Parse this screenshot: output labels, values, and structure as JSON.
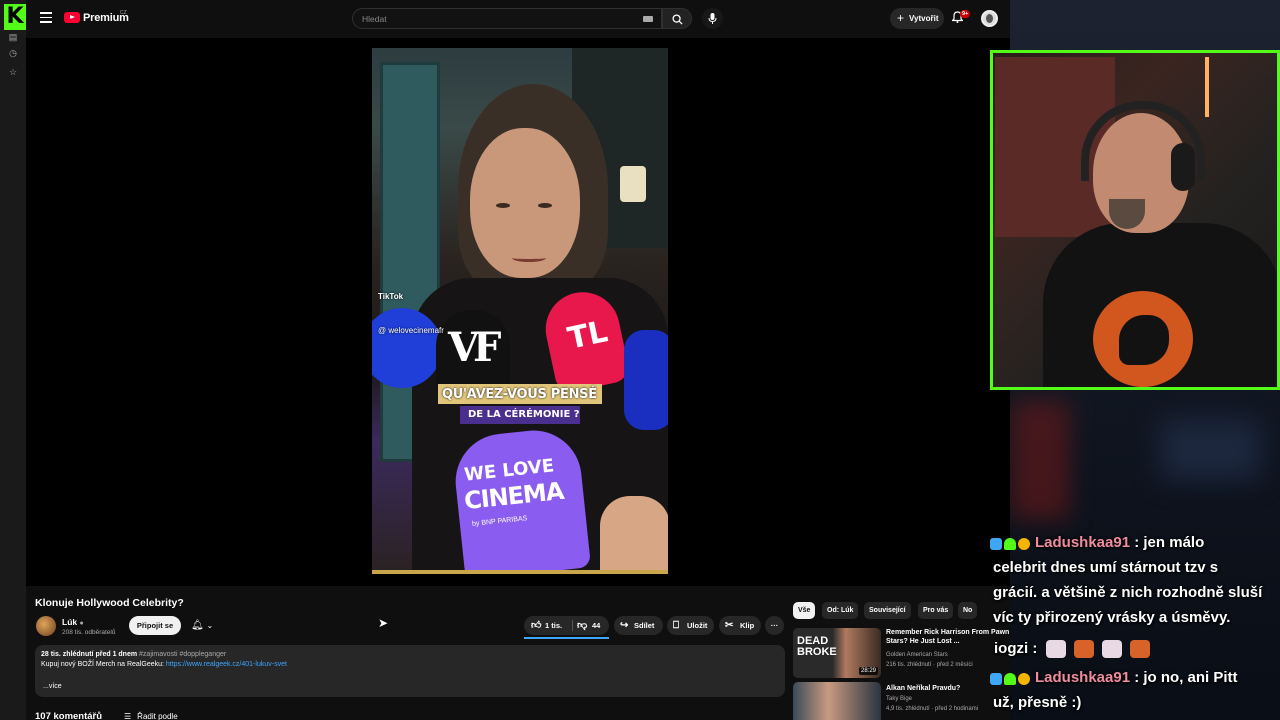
{
  "kick": {
    "logo": "K"
  },
  "topbar": {
    "brand": "Premium",
    "brand_region": "CZ",
    "search_placeholder": "Hledat",
    "create_label": "Vytvořit",
    "notifications_badge": "9+"
  },
  "video": {
    "tiktok_label": "TikTok",
    "tiktok_handle": "@ welovecinemafr",
    "mic_vf": "VF",
    "mic_red": "TL",
    "caption_line1": "QU'AVEZ-VOUS PENSÉ",
    "caption_line2": "DE LA CÉRÉMONIE ?",
    "mic_purple_line1": "WE LOVE",
    "mic_purple_line2": "CINEMA",
    "mic_purple_line3": "by BNP PARIBAS"
  },
  "watch": {
    "title": "Klonuje Hollywood Celebrity?",
    "channel_name": "Lúk",
    "channel_subs": "208 tis. odběratelů",
    "join_label": "Připojit se",
    "like_count": "1 tis.",
    "dislike_count": "44",
    "share_label": "Sdílet",
    "save_label": "Uložit",
    "clip_label": "Klip",
    "more_label": "···"
  },
  "description": {
    "meta": "28 tis. zhlédnutí  před 1 dnem",
    "tags": "#zajimavosti #doppleganger",
    "line": "Kupuj nový BOŽÍ Merch na RealGeeku: ",
    "link": "https://www.realgeek.cz/401-lukuv-svet",
    "more": "...více"
  },
  "comments": {
    "count": "107 komentářů",
    "sort_label": "Řadit podle"
  },
  "chips": [
    "Vše",
    "Od: Lúk",
    "Související",
    "Pro vás",
    "No"
  ],
  "recommendations": [
    {
      "title": "Remember Rick Harrison From Pawn Stars? He Just Lost ...",
      "channel": "Golden American Stars",
      "views": "216 tis. zhlédnutí · před 2 měsíci",
      "duration": "28:29",
      "thumb_text": "DEAD BROKE"
    },
    {
      "title": "Alkan Neříkal Pravdu?",
      "channel": "Taky Bige",
      "views": "4,9 tis. zhlédnutí · před 2 hodinami",
      "duration": ""
    }
  ],
  "chat": [
    {
      "user": "Ladushkaa91",
      "text_line1": "jen málo",
      "text_line2": "celebrit dnes umí stárnout tzv s",
      "text_line3": "grácií. a většině z nich rozhodně sluší",
      "text_line4": "víc ty přirozený vrásky a úsměvy."
    },
    {
      "user": "iogzi",
      "text": ""
    },
    {
      "user": "Ladushkaa91",
      "text_line1": "jo no, ani Pitt",
      "text_line2": "už, přesně :)"
    }
  ],
  "colors": {
    "kick_green": "#53fc18",
    "yt_red": "#ff0033",
    "link_blue": "#3ea6ff",
    "chat_user_pink": "#f08ca0"
  }
}
